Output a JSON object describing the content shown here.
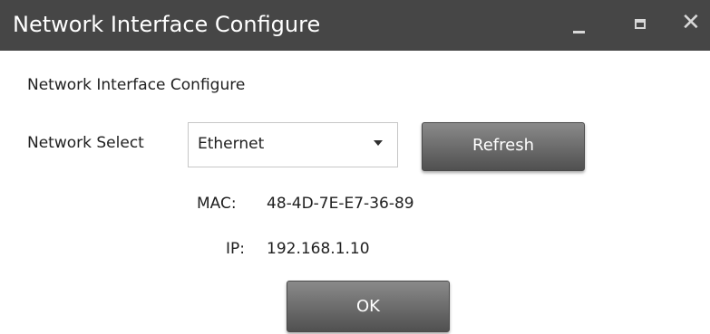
{
  "window": {
    "title": "Network Interface Configure",
    "controls": {
      "minimize_icon": "minimize-icon",
      "maximize_icon": "maximize-icon",
      "close_icon": "close-icon",
      "close_glyph": "✕"
    },
    "colors": {
      "titlebar": "#464646",
      "title_text": "#ffffff",
      "button_gradient_top": "#8a8a8a",
      "button_gradient_bottom": "#505050"
    }
  },
  "content": {
    "heading": "Network Interface Configure",
    "network_select": {
      "label": "Network Select",
      "selected": "Ethernet",
      "dropdown_icon": "chevron-down-icon"
    },
    "refresh_label": "Refresh",
    "mac": {
      "label": "MAC:",
      "value": "48-4D-7E-E7-36-89"
    },
    "ip": {
      "label": "IP:",
      "value": "192.168.1.10"
    },
    "ok_label": "OK"
  }
}
